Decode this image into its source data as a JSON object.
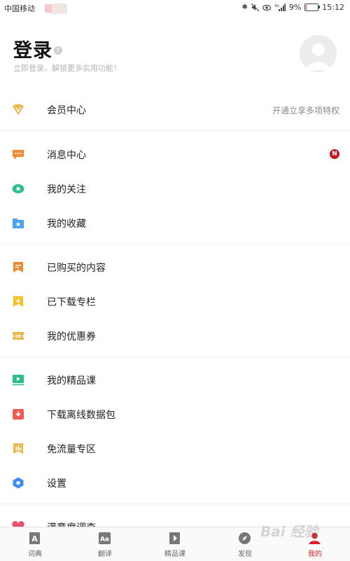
{
  "status_bar": {
    "carrier": "中国移动",
    "battery": "9%",
    "time": "15:12",
    "battery_level": 0.09
  },
  "header": {
    "title": "登录",
    "badge": "Y",
    "subtitle": "立即登录，解锁更多实用功能！"
  },
  "menu": {
    "items": [
      {
        "label": "会员中心",
        "right_text": "开通立享多项特权",
        "icon": "vip-diamond-icon",
        "color": "#e8b84d"
      },
      {
        "label": "消息中心",
        "badge": "N",
        "icon": "message-bubble-icon",
        "color": "#f28b2f"
      },
      {
        "label": "我的关注",
        "icon": "eye-icon",
        "color": "#2dbf8c"
      },
      {
        "label": "我的收藏",
        "icon": "star-folder-icon",
        "color": "#4aa3f0"
      },
      {
        "label": "已购买的内容",
        "icon": "bookmark-icon",
        "color": "#f08a2f"
      },
      {
        "label": "已下载专栏",
        "icon": "download-bookmark-icon",
        "color": "#f6c326"
      },
      {
        "label": "我的优惠券",
        "icon": "coupon-icon",
        "color": "#e8b84d"
      },
      {
        "label": "我的精品课",
        "icon": "video-course-icon",
        "color": "#2dbf8c"
      },
      {
        "label": "下载离线数据包",
        "icon": "download-package-icon",
        "color": "#ee5a4f"
      },
      {
        "label": "免流量专区",
        "icon": "data-free-icon",
        "color": "#e8b84d"
      },
      {
        "label": "设置",
        "icon": "settings-hexagon-icon",
        "color": "#3a8ff0"
      },
      {
        "label": "满意度调查",
        "icon": "heart-icon",
        "color": "#e8506e"
      }
    ]
  },
  "tab_bar": {
    "tabs": [
      {
        "label": "词典",
        "icon": "dictionary-icon"
      },
      {
        "label": "翻译",
        "icon": "translate-icon"
      },
      {
        "label": "精品课",
        "icon": "course-icon"
      },
      {
        "label": "发现",
        "icon": "compass-icon"
      },
      {
        "label": "我的",
        "icon": "profile-icon"
      }
    ],
    "active": "我的",
    "active_color": "#d8232a"
  },
  "watermark": "Bai 经验"
}
